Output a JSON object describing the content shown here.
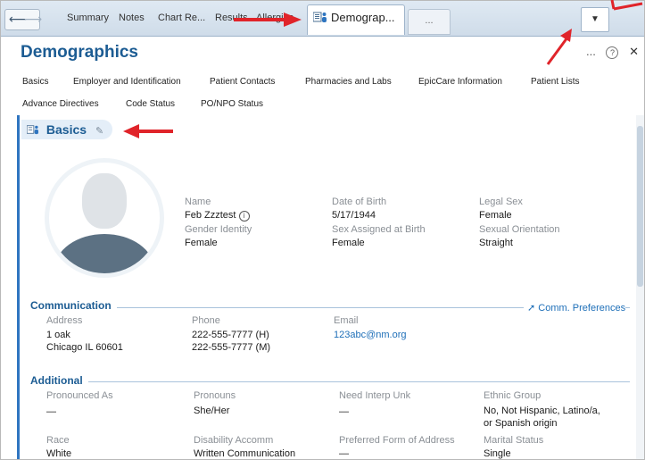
{
  "tabs": {
    "items": [
      "Summary",
      "Notes",
      "Chart Re...",
      "Results",
      "Allergies"
    ],
    "active": "Demograp...",
    "overflow": "..."
  },
  "header": {
    "title": "Demographics",
    "more": "...",
    "help": "?",
    "close": "✕"
  },
  "section_nav": {
    "row1": [
      "Basics",
      "Employer and Identification",
      "Patient Contacts",
      "Pharmacies and Labs",
      "EpicCare Information",
      "Patient Lists"
    ],
    "row2": [
      "Advance Directives",
      "Code Status",
      "PO/NPO Status"
    ]
  },
  "basics": {
    "title": "Basics",
    "name_label": "Name",
    "name_value": "Feb Zzztest",
    "dob_label": "Date of Birth",
    "dob_value": "5/17/1944",
    "legal_sex_label": "Legal Sex",
    "legal_sex_value": "Female",
    "gender_identity_label": "Gender Identity",
    "gender_identity_value": "Female",
    "sex_assigned_label": "Sex Assigned at Birth",
    "sex_assigned_value": "Female",
    "sexual_orientation_label": "Sexual Orientation",
    "sexual_orientation_value": "Straight"
  },
  "communication": {
    "title": "Communication",
    "preferences_link": "Comm. Preferences",
    "address_label": "Address",
    "address_line1": "1 oak",
    "address_line2": "Chicago IL 60601",
    "phone_label": "Phone",
    "phone_home": "222-555-7777 (H)",
    "phone_mobile": "222-555-7777 (M)",
    "email_label": "Email",
    "email_value": "123abc@nm.org"
  },
  "additional": {
    "title": "Additional",
    "pronounced_label": "Pronounced As",
    "pronounced_value": "—",
    "pronouns_label": "Pronouns",
    "pronouns_value": "She/Her",
    "interp_label": "Need Interp Unk",
    "interp_value": "—",
    "ethnic_label": "Ethnic Group",
    "ethnic_value_line1": "No, Not Hispanic, Latino/a,",
    "ethnic_value_line2": "or Spanish origin",
    "race_label": "Race",
    "race_value": "White",
    "disability_label": "Disability Accomm",
    "disability_value": "Written Communication",
    "address_form_label": "Preferred Form of Address",
    "address_form_value": "—",
    "marital_label": "Marital Status",
    "marital_value": "Single"
  },
  "colors": {
    "accent": "#1c5c93",
    "link": "#1e6fb8",
    "annotation": "#e0242a"
  }
}
